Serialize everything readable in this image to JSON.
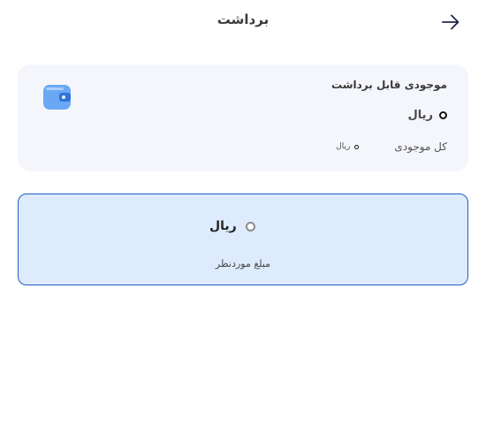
{
  "header": {
    "title": "برداشت",
    "back_icon": "arrow-right-icon"
  },
  "balance": {
    "wallet_icon": "wallet-icon",
    "available_label": "موجودی قابل برداشت",
    "available_currency": "ریال",
    "total_label": "کل موجودی",
    "total_currency": "ریال"
  },
  "amount": {
    "currency": "ریال",
    "label": "مبلغ موردنظر"
  },
  "colors": {
    "accent": "#1d5fc4",
    "card_bg": "#f4f6fb",
    "input_bg": "#deebfd",
    "wallet": "#5b9cf0"
  }
}
